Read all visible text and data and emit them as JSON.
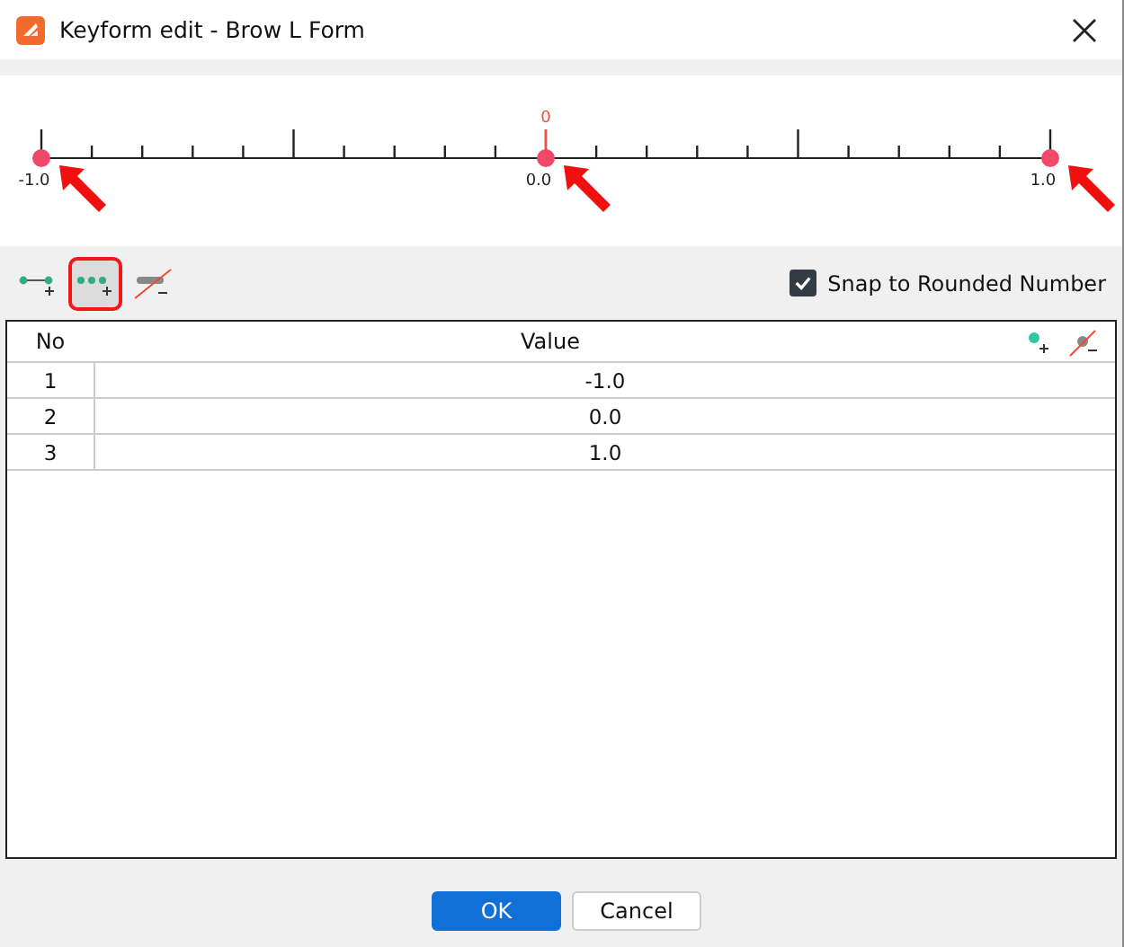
{
  "window": {
    "title": "Keyform edit - Brow L Form"
  },
  "ruler": {
    "current_label": "0",
    "keys": [
      {
        "label": "-1.0",
        "annotated": true
      },
      {
        "label": "0.0",
        "annotated": true
      },
      {
        "label": "1.0",
        "annotated": true
      }
    ]
  },
  "toolbar": {
    "buttons": [
      {
        "kind": "add-key",
        "highlighted": false
      },
      {
        "kind": "add-keys",
        "highlighted": true
      },
      {
        "kind": "remove-key",
        "highlighted": false
      }
    ],
    "snap": {
      "label": "Snap to Rounded Number",
      "checked": true
    }
  },
  "table": {
    "columns": [
      "No",
      "Value"
    ],
    "rows": [
      {
        "no": "1",
        "value": "-1.0"
      },
      {
        "no": "2",
        "value": "0.0"
      },
      {
        "no": "3",
        "value": "1.0"
      }
    ]
  },
  "buttons": [
    {
      "label": "OK",
      "kind": "primary"
    },
    {
      "label": "Cancel",
      "kind": "secondary"
    }
  ]
}
